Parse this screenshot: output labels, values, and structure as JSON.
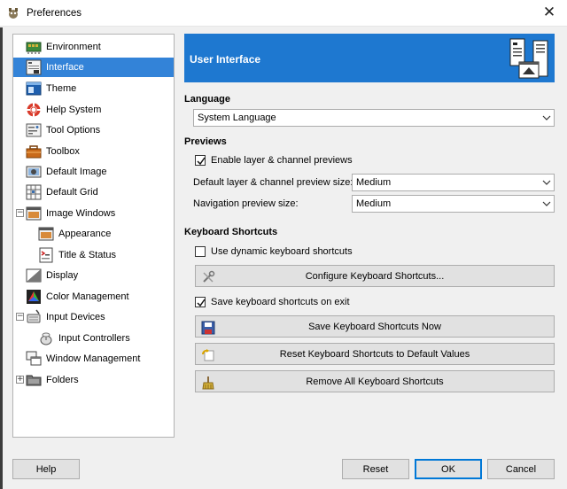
{
  "window": {
    "title": "Preferences",
    "close_glyph": "✕"
  },
  "tree": {
    "items": [
      {
        "label": "Environment",
        "icon": "environment-icon"
      },
      {
        "label": "Interface",
        "icon": "interface-icon",
        "selected": true
      },
      {
        "label": "Theme",
        "icon": "theme-icon"
      },
      {
        "label": "Help System",
        "icon": "help-system-icon"
      },
      {
        "label": "Tool Options",
        "icon": "tool-options-icon"
      },
      {
        "label": "Toolbox",
        "icon": "toolbox-icon"
      },
      {
        "label": "Default Image",
        "icon": "default-image-icon"
      },
      {
        "label": "Default Grid",
        "icon": "default-grid-icon"
      },
      {
        "label": "Image Windows",
        "icon": "image-windows-icon",
        "expander": "−"
      },
      {
        "label": "Appearance",
        "icon": "appearance-icon"
      },
      {
        "label": "Title & Status",
        "icon": "title-status-icon"
      },
      {
        "label": "Display",
        "icon": "display-icon"
      },
      {
        "label": "Color Management",
        "icon": "color-management-icon"
      },
      {
        "label": "Input Devices",
        "icon": "input-devices-icon",
        "expander": "−"
      },
      {
        "label": "Input Controllers",
        "icon": "input-controllers-icon"
      },
      {
        "label": "Window Management",
        "icon": "window-management-icon"
      },
      {
        "label": "Folders",
        "icon": "folders-icon",
        "expander": "+"
      }
    ]
  },
  "banner": {
    "title": "User Interface"
  },
  "language": {
    "section": "Language",
    "value": "System Language"
  },
  "previews": {
    "section": "Previews",
    "enable_label": "Enable layer & channel previews",
    "enable_checked": true,
    "preview_size_label": "Default layer & channel preview size:",
    "preview_size_value": "Medium",
    "nav_size_label": "Navigation preview size:",
    "nav_size_value": "Medium"
  },
  "shortcuts": {
    "section": "Keyboard Shortcuts",
    "dynamic_label": "Use dynamic keyboard shortcuts",
    "dynamic_checked": false,
    "configure_label": "Configure Keyboard Shortcuts...",
    "save_on_exit_label": "Save keyboard shortcuts on exit",
    "save_on_exit_checked": true,
    "save_now_label": "Save Keyboard Shortcuts Now",
    "reset_label": "Reset Keyboard Shortcuts to Default Values",
    "remove_label": "Remove All Keyboard Shortcuts"
  },
  "footer": {
    "help_label": "Help",
    "reset_label": "Reset",
    "ok_label": "OK",
    "cancel_label": "Cancel"
  },
  "colors": {
    "selection": "#3383d8",
    "banner": "#1e78d0",
    "default_button_border": "#0078d7"
  }
}
